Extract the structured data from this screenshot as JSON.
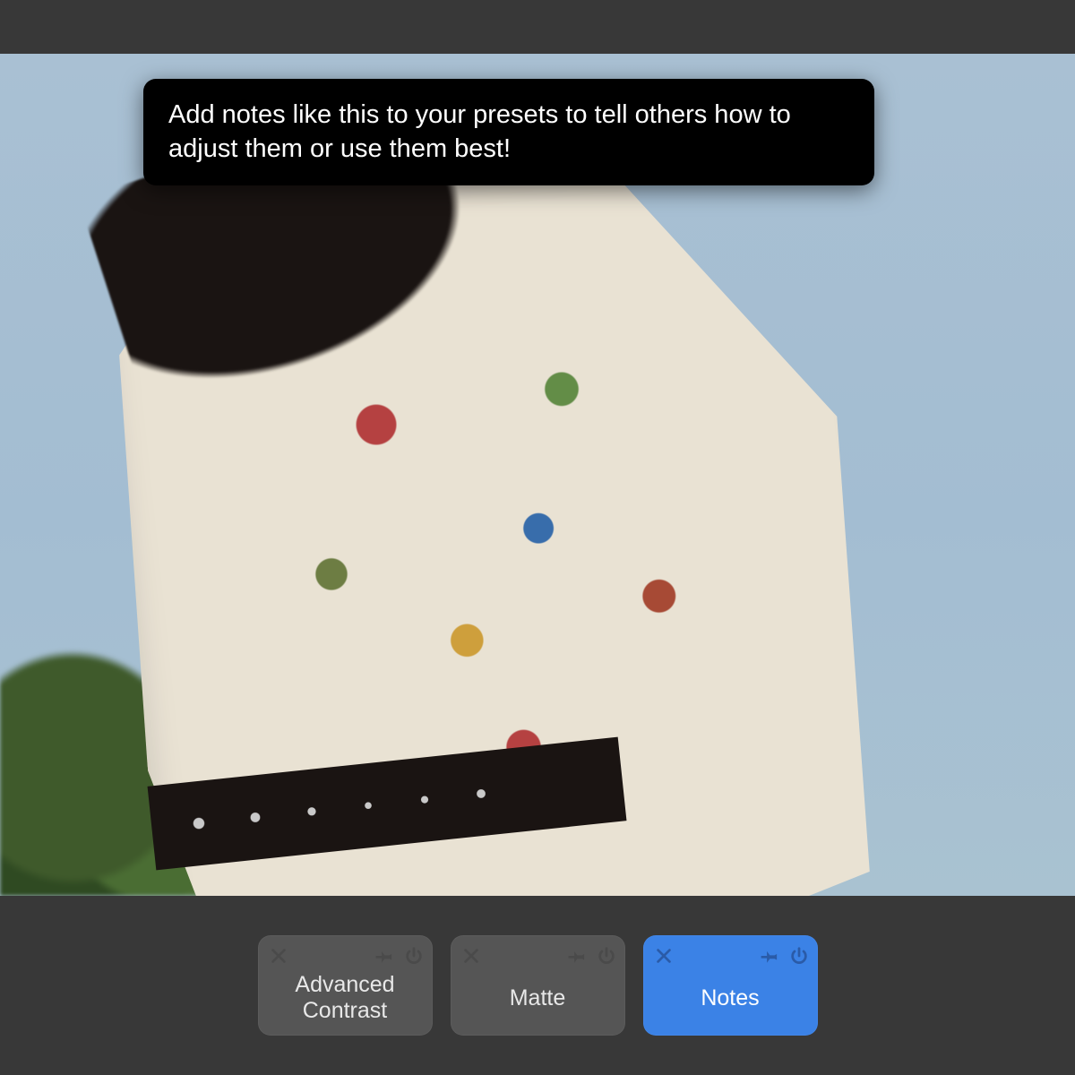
{
  "tooltip": {
    "text": "Add notes like this to your presets to tell others how to adjust them or use them best!"
  },
  "toolrow": {
    "tiles": [
      {
        "label": "Advanced Contrast",
        "active": false
      },
      {
        "label": "Matte",
        "active": false
      },
      {
        "label": "Notes",
        "active": true
      }
    ]
  },
  "colors": {
    "background": "#2a2a2a",
    "panel": "#383838",
    "tile": "#555555",
    "tile_active": "#3b82e6"
  }
}
